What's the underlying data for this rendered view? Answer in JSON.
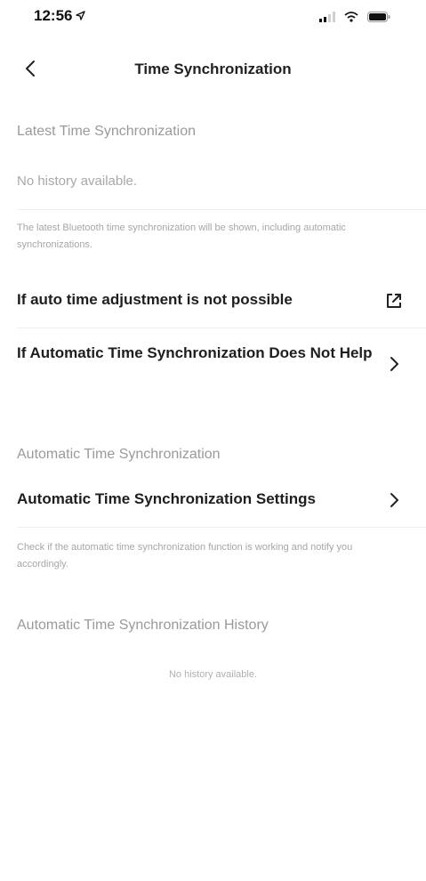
{
  "status_bar": {
    "time": "12:56"
  },
  "nav": {
    "title": "Time Synchronization"
  },
  "latest": {
    "header": "Latest Time Synchronization",
    "empty": "No history available.",
    "note": "The latest Bluetooth time synchronization will be shown, including automatic synchronizations."
  },
  "rows": {
    "auto_adjust": "If auto time adjustment is not possible",
    "not_help": "If Automatic Time Synchronization Does Not Help"
  },
  "automatic": {
    "header": "Automatic Time Synchronization",
    "settings_label": "Automatic Time Synchronization Settings",
    "note": "Check if the automatic time synchronization function is working and notify you accordingly."
  },
  "history": {
    "header": "Automatic Time Synchronization History",
    "empty": "No history available."
  },
  "colors": {
    "background": "#ffffff",
    "section_header": "#9a9a9a",
    "primary_text": "#1e1e1e"
  }
}
